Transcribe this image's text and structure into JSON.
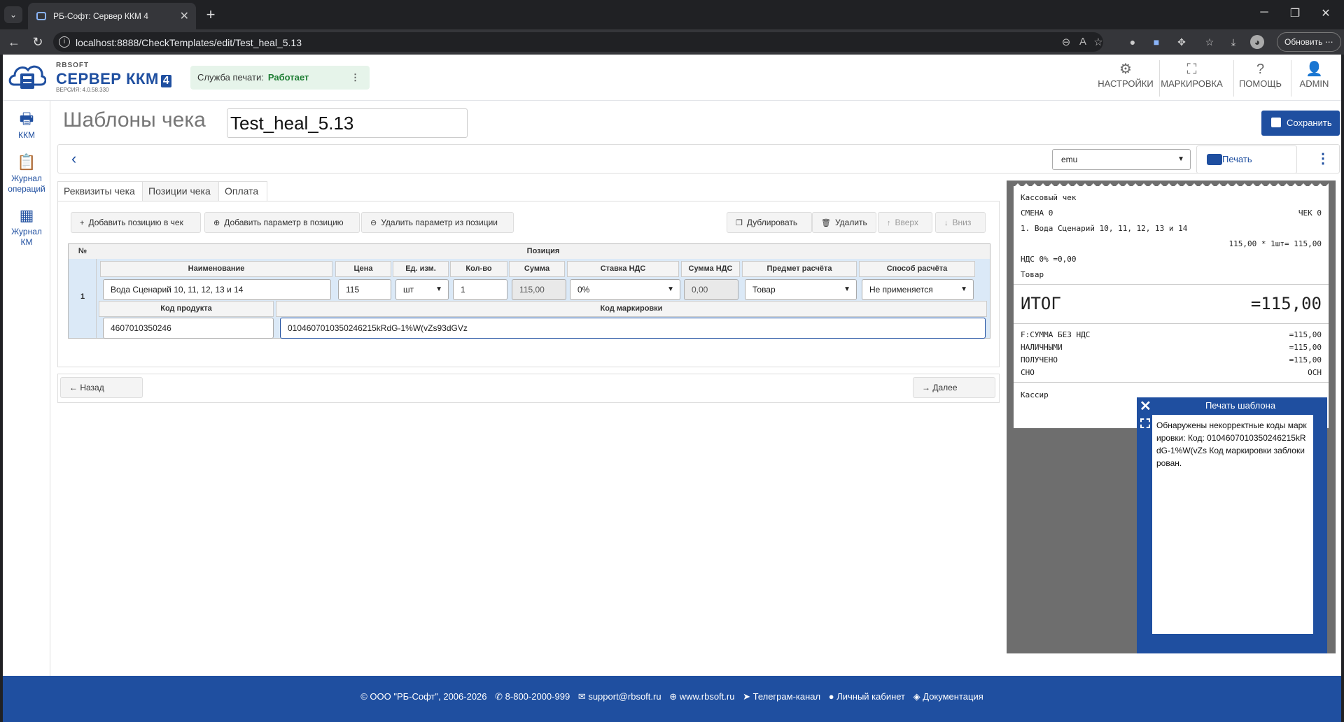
{
  "browser": {
    "tab_title": "РБ-Софт: Сервер ККМ 4",
    "url": "localhost:8888/CheckTemplates/edit/Test_heal_5.13",
    "update_label": "Обновить"
  },
  "header": {
    "brand": "RBSOFT",
    "product": "СЕРВЕР ККМ",
    "product_version_tag": "4",
    "version": "ВЕРСИЯ: 4.0.58.330",
    "print_service_label": "Служба печати:",
    "print_service_status": "Работает",
    "nav": [
      {
        "label": "НАСТРОЙКИ",
        "icon": "gear-icon"
      },
      {
        "label": "МАРКИРОВКА",
        "icon": "scan-icon"
      },
      {
        "label": "ПОМОЩЬ",
        "icon": "help-icon"
      },
      {
        "label": "ADMIN",
        "icon": "user-icon"
      }
    ]
  },
  "sidebar": {
    "items": [
      {
        "label": "ККМ",
        "icon": "printer-icon"
      },
      {
        "label": "Журнал операций",
        "icon": "clipboard-icon"
      },
      {
        "label": "Журнал КМ",
        "icon": "qr-icon"
      }
    ]
  },
  "page": {
    "title": "Шаблоны чека",
    "template_name": "Test_heal_5.13",
    "save_label": "Сохранить",
    "device": "emu",
    "print_label": "Печать"
  },
  "tabs": [
    {
      "label": "Реквизиты чека",
      "active": false
    },
    {
      "label": "Позиции чека",
      "active": true
    },
    {
      "label": "Оплата",
      "active": false
    }
  ],
  "actions": {
    "add_position": "Добавить позицию в чек",
    "add_param": "Добавить параметр в позицию",
    "remove_param": "Удалить параметр из позиции",
    "duplicate": "Дублировать",
    "delete": "Удалить",
    "up": "Вверх",
    "down": "Вниз"
  },
  "table": {
    "col_num": "№",
    "col_position": "Позиция",
    "headers": {
      "name": "Наименование",
      "price": "Цена",
      "unit": "Ед. изм.",
      "qty": "Кол-во",
      "sum": "Сумма",
      "vat_rate": "Ставка НДС",
      "vat_sum": "Сумма НДС",
      "subject": "Предмет расчёта",
      "method": "Способ расчёта",
      "product_code": "Код продукта",
      "marking_code": "Код маркировки"
    },
    "rows": [
      {
        "num": "1",
        "name": "Вода Сценарий 10, 11, 12, 13 и 14",
        "price": "115",
        "unit": "шт",
        "qty": "1",
        "sum": "115,00",
        "vat_rate": "0%",
        "vat_sum": "0,00",
        "subject": "Товар",
        "method": "Не применяется",
        "product_code": "4607010350246",
        "marking_code": "0104607010350246215kRdG-1%W(vZs93dGVz"
      }
    ]
  },
  "nav_buttons": {
    "back": "Назад",
    "next": "Далее"
  },
  "receipt": {
    "title": "Кассовый чек",
    "shift": "СМЕНА 0",
    "check": "ЧЕК 0",
    "item_line": "1. Вода Сценарий 10, 11, 12, 13 и 14",
    "item_calc": "115,00 * 1шт= 115,00",
    "vat_line": "НДС 0% =0,00",
    "subject": "Товар",
    "total_label": "ИТОГ",
    "total_value": "=115,00",
    "lines": [
      {
        "label": "F:СУММА БЕЗ НДС",
        "value": "=115,00"
      },
      {
        "label": "НАЛИЧНЫМИ",
        "value": "=115,00"
      },
      {
        "label": "ПОЛУЧЕНО",
        "value": "=115,00"
      },
      {
        "label": "СНО",
        "value": "ОСН"
      }
    ],
    "cashier": "Кассир"
  },
  "dialog": {
    "title": "Печать шаблона",
    "message": "Обнаружены некорректные коды маркировки: Код: 0104607010350246215kRdG-1%W(vZs Код маркировки заблокирован."
  },
  "footer": {
    "copyright": "© ООО \"РБ-Софт\", 2006-2026",
    "phone": "8-800-2000-999",
    "email": "support@rbsoft.ru",
    "site": "www.rbsoft.ru",
    "telegram": "Телеграм-канал",
    "cabinet": "Личный кабинет",
    "docs": "Документация"
  },
  "colors": {
    "brand": "#1f4fa0",
    "status_ok": "#1e7e34",
    "row_highlight": "#dbe9f7"
  }
}
